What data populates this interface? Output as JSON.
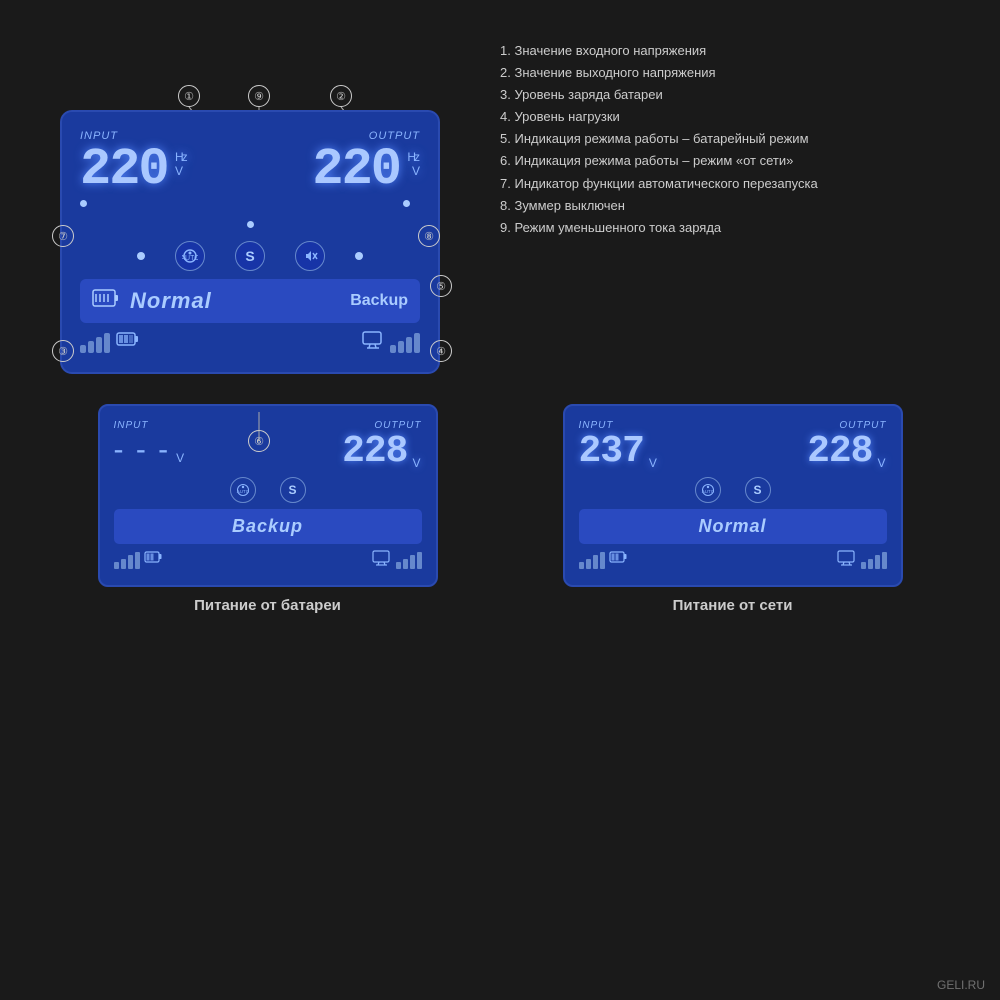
{
  "legend": {
    "items": [
      {
        "num": "1.",
        "text": "Значение входного напряжения"
      },
      {
        "num": "2.",
        "text": "Значение выходного напряжения"
      },
      {
        "num": "3.",
        "text": "Уровень заряда батареи"
      },
      {
        "num": "4.",
        "text": "Уровень нагрузки"
      },
      {
        "num": "5.",
        "text": "Индикация режима работы – батарейный режим"
      },
      {
        "num": "6.",
        "text": "Индикация режима работы – режим «от сети»"
      },
      {
        "num": "7.",
        "text": "Индикатор функции автоматического перезапуска"
      },
      {
        "num": "8.",
        "text": "Зуммер выключен"
      },
      {
        "num": "9.",
        "text": "Режим уменьшенного тока заряда"
      }
    ]
  },
  "main_panel": {
    "input_label": "INPUT",
    "output_label": "OUTPUT",
    "input_value": "220",
    "output_value": "220",
    "status_text": "Normal",
    "backup_label": "Backup"
  },
  "bottom_left": {
    "input_label": "INPUT",
    "output_label": "OUTPUT",
    "input_value": "---",
    "output_value": "228",
    "status_text": "Backup",
    "caption": "Питание от батареи"
  },
  "bottom_right": {
    "input_label": "INPUT",
    "output_label": "OUTPUT",
    "input_value": "237",
    "output_value": "228",
    "status_text": "Normal",
    "caption": "Питание от сети"
  },
  "annotations": {
    "num1": "①",
    "num2": "②",
    "num3": "③",
    "num4": "④",
    "num5": "⑤",
    "num6": "⑥",
    "num7": "⑦",
    "num8": "⑧",
    "num9": "⑨"
  },
  "watermark": "GELI.RU"
}
